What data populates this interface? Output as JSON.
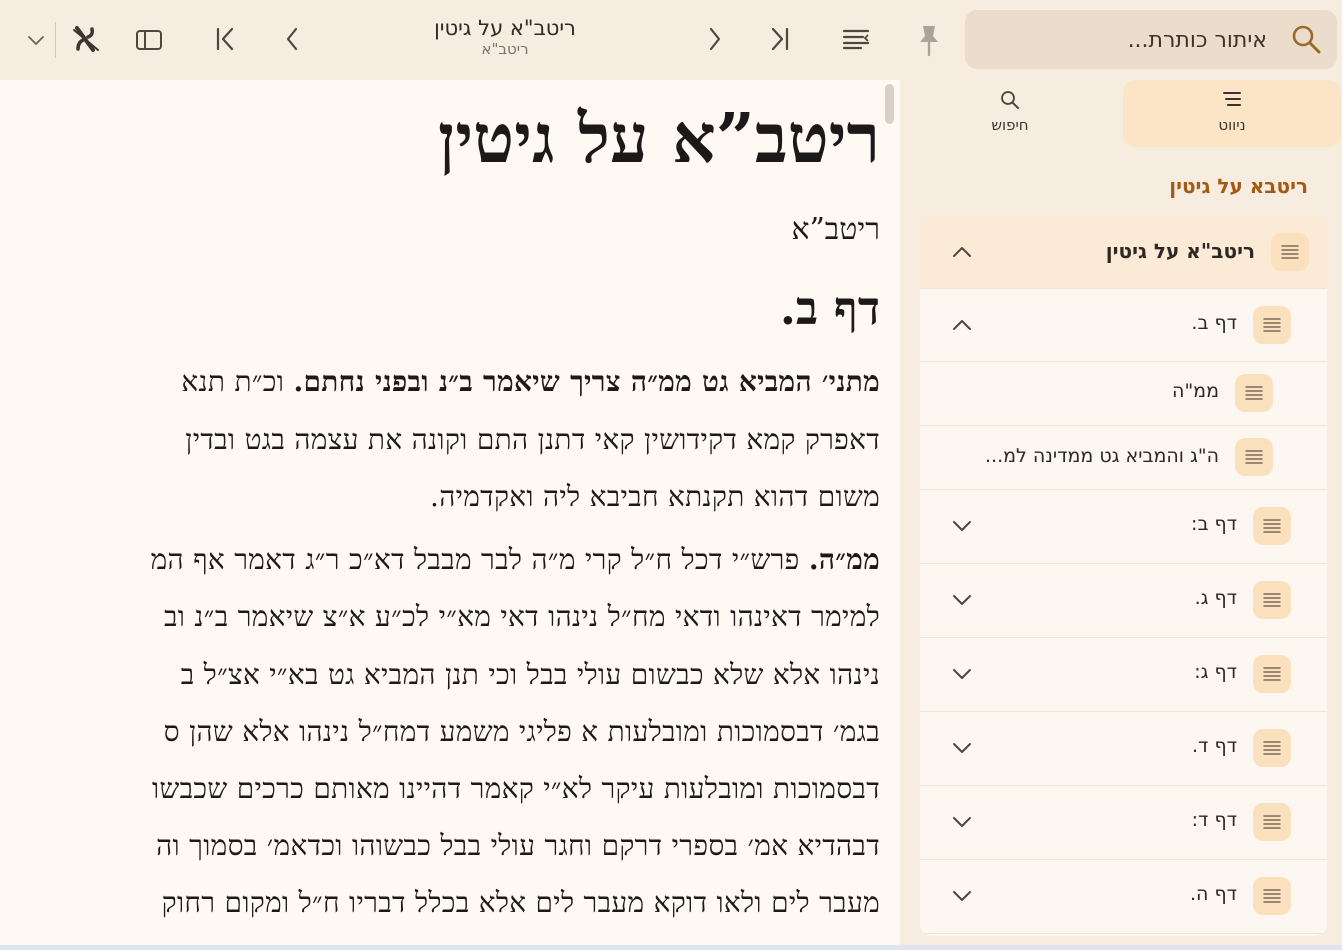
{
  "toolbar": {
    "title": "ריטב\"א על גיטין",
    "subtitle": "ריטב\"א"
  },
  "search": {
    "placeholder": "איתור כותרת..."
  },
  "reader": {
    "book_title": "ריטב”א על גיטין",
    "author": "ריטב”א",
    "daf": "דף ב.",
    "lines": [
      {
        "bold": "מתני׳ המביא גט ממ״ה צריך שיאמר ב״נ ובפני נחתם.",
        "text": " וכ״ת תנא"
      },
      {
        "bold": "",
        "text": "דאפרק קמא דקידושין קאי דתנן התם וקונה את עצמה בגט ובדין"
      },
      {
        "bold": "",
        "text": "משום דהוא תקנתא חביבא ליה ואקדמיה."
      },
      {
        "bold": "ממ״ה.",
        "text": " פרש״י דכל ח״ל קרי מ״ה לבר מבבל דא״כ ר״ג דאמר אף המ"
      },
      {
        "bold": "",
        "text": "למימר דאינהו ודאי מח״ל נינהו דאי מא״י לכ״ע א״צ שיאמר ב״נ וב"
      },
      {
        "bold": "",
        "text": "נינהו אלא שלא כבשום עולי בבל וכי תנן המביא גט בא״י אצ״ל ב"
      },
      {
        "bold": "",
        "text": "בגמ׳ דבסמוכות ומובלעות א פליגי משמע דמח״ל נינהו אלא שהן ס"
      },
      {
        "bold": "",
        "text": "דבסמוכות ומובלעות עיקר לא״י קאמר דהיינו מאותם כרכים שכבשו"
      },
      {
        "bold": "",
        "text": "דבהדיא אמ׳ בספרי דרקם וחגר עולי בבל כבשוהו וכדאמ׳ בסמוך וה"
      },
      {
        "bold": "",
        "text": "מעבר לים ולאו דוקא מעבר לים אלא בכלל דבריו ח״ל ומקום רחוק"
      }
    ]
  },
  "sidebar": {
    "tabs": [
      {
        "label": "ניווט"
      },
      {
        "label": "חיפוש"
      }
    ],
    "book_name": "ריטבא על גיטין",
    "toc": [
      {
        "label": "ריטב\"א על גיטין",
        "state": "expanded"
      },
      {
        "label": "דף ב.",
        "state": "expanded"
      },
      {
        "label": "ממ\"ה",
        "state": "leaf"
      },
      {
        "label": "ה\"ג והמביא גט ממדינה למ...",
        "state": "leaf"
      },
      {
        "label": "דף ב:",
        "state": "collapsed"
      },
      {
        "label": "דף ג.",
        "state": "collapsed"
      },
      {
        "label": "דף ג:",
        "state": "collapsed"
      },
      {
        "label": "דף ד.",
        "state": "collapsed"
      },
      {
        "label": "דף ד:",
        "state": "collapsed"
      },
      {
        "label": "דף ה.",
        "state": "collapsed"
      }
    ]
  },
  "colors": {
    "accent": "#a55a12",
    "toolbar_bg": "#f6ece0",
    "reader_bg": "#fff8f3",
    "tab_active_bg": "#fbe5c6"
  }
}
